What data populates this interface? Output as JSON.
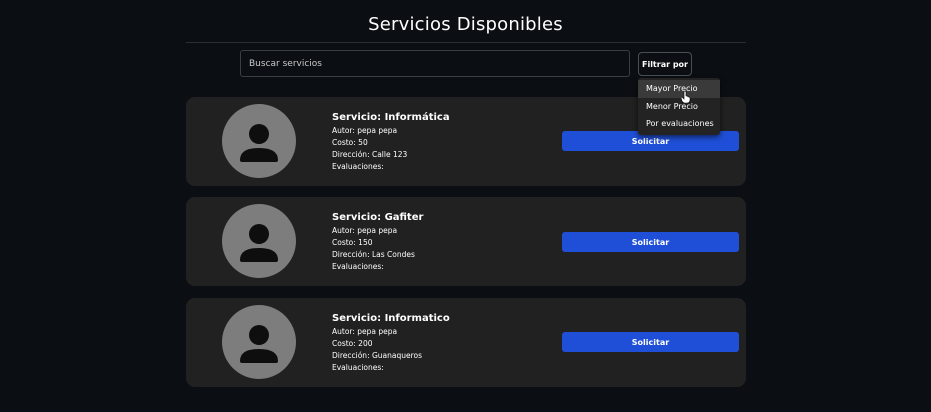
{
  "header": {
    "title": "Servicios Disponibles"
  },
  "search": {
    "placeholder": "Buscar servicios",
    "value": ""
  },
  "filter": {
    "button_label": "Filtrar por",
    "options": [
      "Mayor Precio",
      "Menor Precio",
      "Por evaluaciones"
    ],
    "hovered_option": "Mayor Precio"
  },
  "services": [
    {
      "title": "Servicio: Informática",
      "author": "Autor: pepa pepa",
      "cost": "Costo: 50",
      "address": "Dirección: Calle 123",
      "ratings": "Evaluaciones:",
      "button_label": "Solicitar"
    },
    {
      "title": "Servicio: Gafiter",
      "author": "Autor: pepa pepa",
      "cost": "Costo: 150",
      "address": "Dirección: Las Condes",
      "ratings": "Evaluaciones:",
      "button_label": "Solicitar"
    },
    {
      "title": "Servicio: Informatico",
      "author": "Autor: pepa pepa",
      "cost": "Costo: 200",
      "address": "Dirección: Guanaqueros",
      "ratings": "Evaluaciones:",
      "button_label": "Solicitar"
    }
  ],
  "icons": {
    "avatar": "user-placeholder-icon",
    "cursor": "hand-pointer-icon"
  },
  "colors": {
    "background": "#0b0f13",
    "card": "#212121",
    "button": "#1f4fd6",
    "avatar": "#7d7d7d"
  }
}
